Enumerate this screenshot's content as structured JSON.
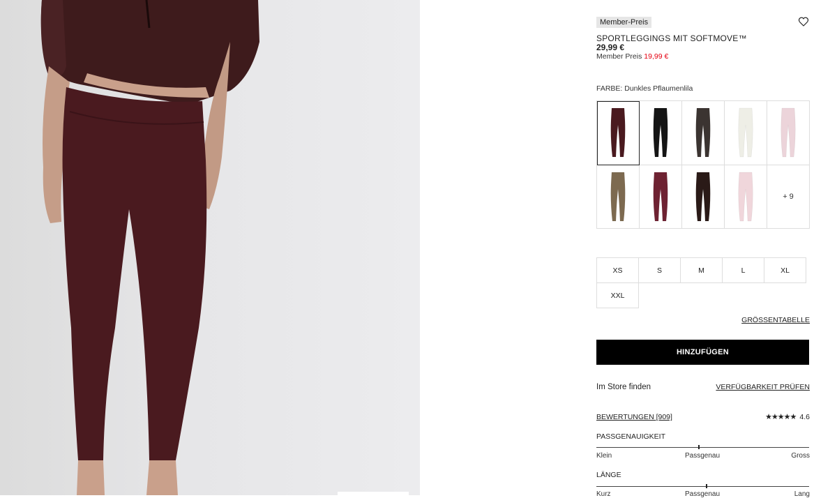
{
  "product": {
    "badge": "Member-Preis",
    "title": "SPORTLEGGINGS MIT SOFTMOVE™",
    "price": "29,99 €",
    "member_price_label": "Member Preis",
    "member_price_value": "19,99 €"
  },
  "color": {
    "label": "FARBE: Dunkles Pflaumenlila",
    "swatches": [
      {
        "color": "#4a1a1f",
        "selected": true
      },
      {
        "color": "#151515",
        "selected": false
      },
      {
        "color": "#3b3431",
        "selected": false
      },
      {
        "color": "#eeeee6",
        "selected": false
      },
      {
        "color": "#ecd4da",
        "selected": false
      },
      {
        "color": "#7d6a50",
        "selected": false
      },
      {
        "color": "#6e2232",
        "selected": false
      },
      {
        "color": "#2a1a17",
        "selected": false
      },
      {
        "color": "#f0d6db",
        "selected": false
      }
    ],
    "more_label": "+ 9"
  },
  "sizes": [
    "XS",
    "S",
    "M",
    "L",
    "XL",
    "XXL"
  ],
  "size_guide": "GRÖSSENTABELLE",
  "add_to_cart": "HINZUFÜGEN",
  "store": {
    "find_label": "Im Store finden",
    "check_label": "VERFÜGBARKEIT PRÜFEN"
  },
  "reviews": {
    "label": "BEWERTUNGEN [909]",
    "stars": "★★★★★",
    "score": "4.6"
  },
  "fit": {
    "title": "PASSGENAUIGKEIT",
    "left": "Klein",
    "mid": "Passgenau",
    "right": "Gross"
  },
  "length": {
    "title": "LÄNGE",
    "left": "Kurz",
    "mid": "Passgenau",
    "right": "Lang"
  }
}
